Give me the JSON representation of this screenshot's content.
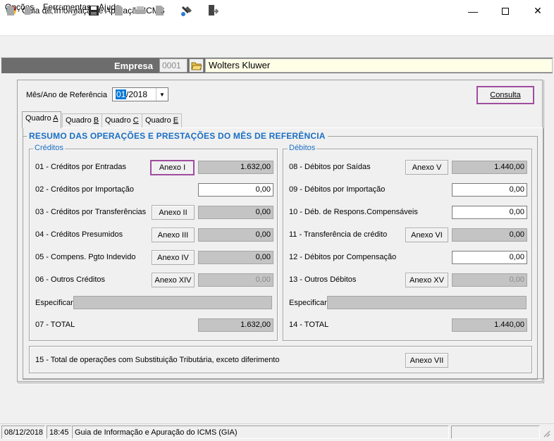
{
  "window": {
    "title": "Guia de Informação e Apuração ICMS",
    "minimize": "—",
    "maximize": "☐",
    "close": "✕"
  },
  "menu": {
    "opcoes": "Opções",
    "ferramentas": "Ferramentas",
    "ajuda": "Ajuda"
  },
  "toolbar": {
    "icons": [
      "new-doc-icon",
      "edit-icon",
      "delete-icon",
      "undo-icon",
      "save-icon",
      "print-preview-icon",
      "print-icon",
      "export-icon",
      "import-icon",
      "tools-icon",
      "exit-icon"
    ]
  },
  "empresa": {
    "label": "Empresa",
    "code": "0001",
    "name": "Wolters Kluwer"
  },
  "ref": {
    "label": "Mês/Ano de Referência",
    "month": "01",
    "rest": "/2018",
    "consulta": "Consulta"
  },
  "tabs": [
    {
      "text": "Quadro ",
      "key": "A"
    },
    {
      "text": "Quadro ",
      "key": "B"
    },
    {
      "text": "Quadro ",
      "key": "C"
    },
    {
      "text": "Quadro ",
      "key": "E"
    }
  ],
  "resumo_title": "RESUMO DAS OPERAÇÕES E PRESTAÇÕES DO MÊS DE REFERÊNCIA",
  "creditos": {
    "title": "Créditos",
    "rows": [
      {
        "label": "01 - Créditos por Entradas",
        "button": "Anexo I",
        "value": "1.632,00"
      },
      {
        "label": "02 - Créditos por Importação",
        "button": "",
        "value": "0,00"
      },
      {
        "label": "03 - Créditos por Transferências",
        "button": "Anexo II",
        "value": "0,00"
      },
      {
        "label": "04 - Créditos Presumidos",
        "button": "Anexo III",
        "value": "0,00"
      },
      {
        "label": "05 - Compens. Pgto Indevido",
        "button": "Anexo IV",
        "value": "0,00"
      },
      {
        "label": "06 - Outros Créditos",
        "button": "Anexo  XIV",
        "value": "0,00"
      }
    ],
    "especificar": "Especificar",
    "total_label": "07 - TOTAL",
    "total_value": "1.632,00"
  },
  "debitos": {
    "title": "Débitos",
    "rows": [
      {
        "label": "08 - Débitos por Saídas",
        "button": "Anexo V",
        "value": "1.440,00"
      },
      {
        "label": "09 - Débitos por Importação",
        "button": "",
        "value": "0,00"
      },
      {
        "label": "10 - Déb. de Respons.Compensáveis",
        "button": "",
        "value": "0,00"
      },
      {
        "label": "11 - Transferência de crédito",
        "button": "Anexo VI",
        "value": "0,00"
      },
      {
        "label": "12 - Débitos por Compensação",
        "button": "",
        "value": "0,00"
      },
      {
        "label": "13 - Outros Débitos",
        "button": "Anexo  XV",
        "value": "0,00"
      }
    ],
    "especificar": "Especificar",
    "total_label": "14 - TOTAL",
    "total_value": "1.440,00"
  },
  "st": {
    "label": "15 - Total  de operações com Substituição Tributária, exceto diferimento",
    "button": "Anexo VII"
  },
  "status": {
    "date": "08/12/2018",
    "time": "18:45",
    "message": "Guia de Informação e Apuração do ICMS (GIA)"
  }
}
